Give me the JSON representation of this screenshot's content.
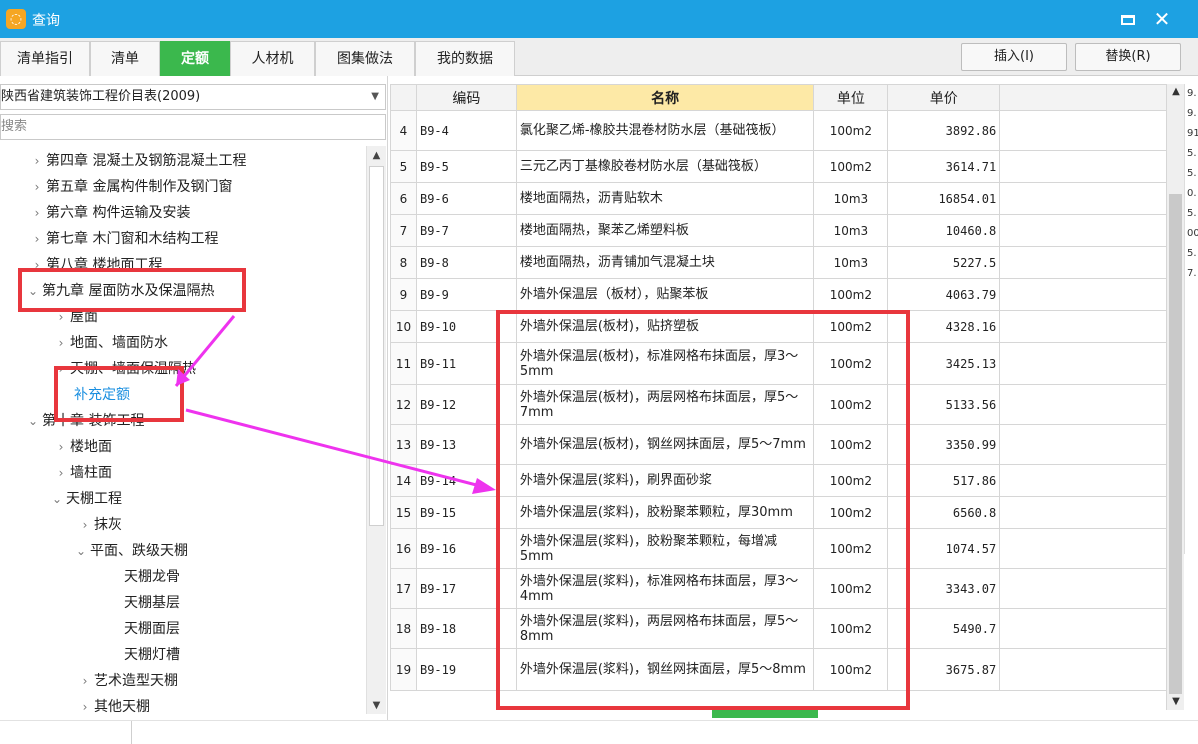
{
  "window": {
    "title": "查询",
    "icon": "app-icon",
    "maximize_icon": "maximize-icon",
    "close_icon": "close-icon",
    "close_glyph": "✕"
  },
  "tabs": [
    {
      "label": "清单指引"
    },
    {
      "label": "清单"
    },
    {
      "label": "定额",
      "active": true
    },
    {
      "label": "人材机"
    },
    {
      "label": "图集做法"
    },
    {
      "label": "我的数据"
    }
  ],
  "toolbar": {
    "insert_label": "插入(I)",
    "replace_label": "替换(R)"
  },
  "left": {
    "library_select": "陕西省建筑装饰工程价目表(2009)",
    "search_placeholder": "搜索",
    "tree": [
      {
        "label": "第四章 混凝土及钢筋混凝土工程",
        "chev": "›"
      },
      {
        "label": "第五章 金属构件制作及钢门窗",
        "chev": "›"
      },
      {
        "label": "第六章 构件运输及安装",
        "chev": "›"
      },
      {
        "label": "第七章 木门窗和木结构工程",
        "chev": "›"
      },
      {
        "label": "第八章 楼地面工程",
        "chev": "›"
      },
      {
        "label": "第九章 屋面防水及保温隔热",
        "chev": "⌄"
      },
      {
        "label": "屋面",
        "chev": "›"
      },
      {
        "label": "地面、墙面防水",
        "chev": "›"
      },
      {
        "label": "天棚、墙面保温隔热",
        "chev": "›"
      },
      {
        "label": "补充定额",
        "chev": ""
      },
      {
        "label": "第十章 装饰工程",
        "chev": "⌄"
      },
      {
        "label": "楼地面",
        "chev": "›"
      },
      {
        "label": "墙柱面",
        "chev": "›"
      },
      {
        "label": "天棚工程",
        "chev": "⌄"
      },
      {
        "label": "抹灰",
        "chev": "›"
      },
      {
        "label": "平面、跌级天棚",
        "chev": "⌄"
      },
      {
        "label": "天棚龙骨",
        "chev": ""
      },
      {
        "label": "天棚基层",
        "chev": ""
      },
      {
        "label": "天棚面层",
        "chev": ""
      },
      {
        "label": "天棚灯槽",
        "chev": ""
      },
      {
        "label": "艺术造型天棚",
        "chev": "›"
      },
      {
        "label": "其他天棚",
        "chev": "›"
      }
    ]
  },
  "grid": {
    "headers": {
      "code": "编码",
      "name": "名称",
      "unit": "单位",
      "price": "单价"
    },
    "rows": [
      {
        "n": "4",
        "code": "B9-4",
        "name": "氯化聚乙烯-橡胶共混卷材防水层（基础筏板）",
        "unit": "100m2",
        "price": "3892.86"
      },
      {
        "n": "5",
        "code": "B9-5",
        "name": "三元乙丙丁基橡胶卷材防水层（基础筏板）",
        "unit": "100m2",
        "price": "3614.71"
      },
      {
        "n": "6",
        "code": "B9-6",
        "name": "楼地面隔热，沥青贴软木",
        "unit": "10m3",
        "price": "16854.01"
      },
      {
        "n": "7",
        "code": "B9-7",
        "name": "楼地面隔热，聚苯乙烯塑料板",
        "unit": "10m3",
        "price": "10460.8"
      },
      {
        "n": "8",
        "code": "B9-8",
        "name": "楼地面隔热，沥青铺加气混凝土块",
        "unit": "10m3",
        "price": "5227.5"
      },
      {
        "n": "9",
        "code": "B9-9",
        "name": "外墙外保温层（板材），贴聚苯板",
        "unit": "100m2",
        "price": "4063.79"
      },
      {
        "n": "10",
        "code": "B9-10",
        "name": "外墙外保温层(板材)，贴挤塑板",
        "unit": "100m2",
        "price": "4328.16"
      },
      {
        "n": "11",
        "code": "B9-11",
        "name": "外墙外保温层(板材)，标准网格布抹面层，厚3～5mm",
        "unit": "100m2",
        "price": "3425.13"
      },
      {
        "n": "12",
        "code": "B9-12",
        "name": "外墙外保温层(板材)，两层网格布抹面层，厚5～7mm",
        "unit": "100m2",
        "price": "5133.56"
      },
      {
        "n": "13",
        "code": "B9-13",
        "name": "外墙外保温层(板材)，钢丝网抹面层，厚5～7mm",
        "unit": "100m2",
        "price": "3350.99"
      },
      {
        "n": "14",
        "code": "B9-14",
        "name": "外墙外保温层(浆料)，刷界面砂浆",
        "unit": "100m2",
        "price": "517.86"
      },
      {
        "n": "15",
        "code": "B9-15",
        "name": "外墙外保温层(浆料)，胶粉聚苯颗粒，厚30mm",
        "unit": "100m2",
        "price": "6560.8"
      },
      {
        "n": "16",
        "code": "B9-16",
        "name": "外墙外保温层(浆料)，胶粉聚苯颗粒，每增减5mm",
        "unit": "100m2",
        "price": "1074.57"
      },
      {
        "n": "17",
        "code": "B9-17",
        "name": "外墙外保温层(浆料)，标准网格布抹面层，厚3～4mm",
        "unit": "100m2",
        "price": "3343.07"
      },
      {
        "n": "18",
        "code": "B9-18",
        "name": "外墙外保温层(浆料)，两层网格布抹面层，厚5～8mm",
        "unit": "100m2",
        "price": "5490.7"
      },
      {
        "n": "19",
        "code": "B9-19",
        "name": "外墙外保温层(浆料)，钢丝网抹面层，厚5～8mm",
        "unit": "100m2",
        "price": "3675.87"
      }
    ]
  },
  "right_edge_fragments": [
    "9.",
    "9.",
    "91",
    "5.",
    "5.",
    "0.",
    "5.",
    "00",
    "5.",
    "7."
  ],
  "colors": {
    "titlebar": "#1da1e2",
    "active_tab": "#3bb84d",
    "header_highlight": "#fde9a6",
    "annotation_red": "#e8363d",
    "annotation_magenta": "#ee33ee",
    "link_blue": "#1a8fe0"
  }
}
